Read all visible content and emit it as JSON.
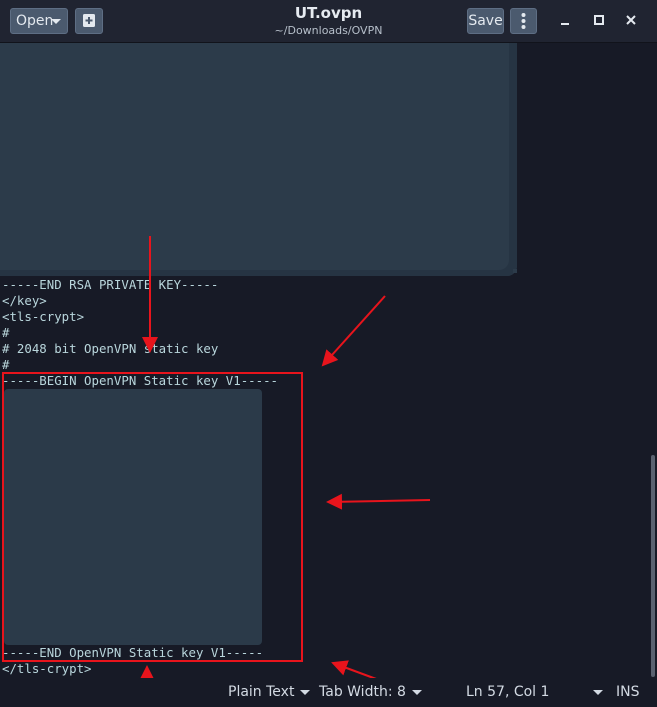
{
  "header": {
    "open_label": "Open",
    "title": "UT.ovpn",
    "subtitle": "~/Downloads/OVPN",
    "save_label": "Save"
  },
  "editor": {
    "lines": [
      "-----END RSA PRIVATE KEY-----",
      "</key>",
      "<tls-crypt>",
      "#",
      "# 2048 bit OpenVPN static key",
      "#",
      "-----BEGIN OpenVPN Static key V1-----",
      "-----END OpenVPN Static key V1-----",
      "</tls-crypt>"
    ]
  },
  "statusbar": {
    "language": "Plain Text",
    "tab_width": "Tab Width: 8",
    "position": "Ln 57, Col 1",
    "mode": "INS"
  },
  "colors": {
    "background": "#171a26",
    "header": "#202431",
    "text": "#b9d6dc",
    "annotation": "#e8141c",
    "redaction": "#2c3b4a"
  }
}
